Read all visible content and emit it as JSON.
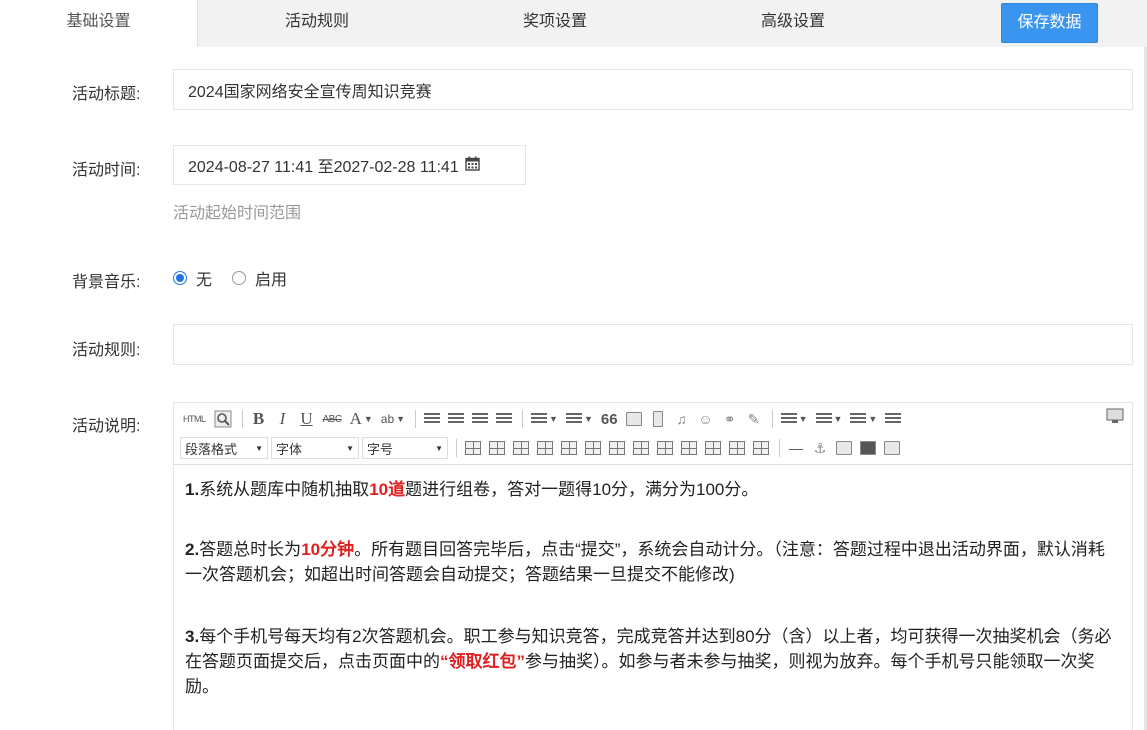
{
  "tabs": [
    {
      "label": "基础设置",
      "active": true
    },
    {
      "label": "活动规则",
      "active": false
    },
    {
      "label": "奖项设置",
      "active": false
    },
    {
      "label": "高级设置",
      "active": false
    }
  ],
  "save_button": "保存数据",
  "form": {
    "title_label": "活动标题:",
    "title_value": "2024国家网络安全宣传周知识竞赛",
    "time_label": "活动时间:",
    "time_value": "2024-08-27 11:41 至2027-02-28 11:41",
    "time_hint": "活动起始时间范围",
    "music_label": "背景音乐:",
    "music_options": [
      {
        "label": "无",
        "checked": true
      },
      {
        "label": "启用",
        "checked": false
      }
    ],
    "rules_label": "活动规则:",
    "rules_value": "",
    "desc_label": "活动说明:"
  },
  "editor": {
    "toolbar": {
      "html_label": "HTML",
      "bold": "B",
      "italic": "I",
      "underline": "U",
      "strike": "ABC",
      "font_color": "A",
      "highlight": "ab",
      "quote": "66",
      "paragraph_format": "段落格式",
      "font_family": "字体",
      "font_size": "字号"
    },
    "content": {
      "p1": {
        "num": "1.",
        "a": "系统从题库中随机抽取",
        "red": "10道",
        "b": "题进行组卷，答对一题得10分，满分为100分。"
      },
      "p2": {
        "num": "2.",
        "a": "答题总时长为",
        "red": "10分钟",
        "b": "。所有题目回答完毕后，点击“提交”，系统会自动计分。（注意：答题过程中退出活动界面，默认消耗一次答题机会；如超出时间答题会自动提交；答题结果一旦提交不能修改)"
      },
      "p3": {
        "num": "3.",
        "a": "每个手机号每天均有2次答题机会。职工参与知识竞答，完成竞答并达到80分（含）以上者，均可获得一次抽奖机会（务必在答题页面提交后，点击页面中的",
        "red": "“领取红包”",
        "b": "参与抽奖）。如参与者未参与抽奖，则视为放弃。每个手机号只能领取一次奖励。"
      }
    }
  },
  "colors": {
    "accent": "#3a95f0",
    "highlight_red": "#e02020",
    "radio_checked": "#1e73e8"
  }
}
